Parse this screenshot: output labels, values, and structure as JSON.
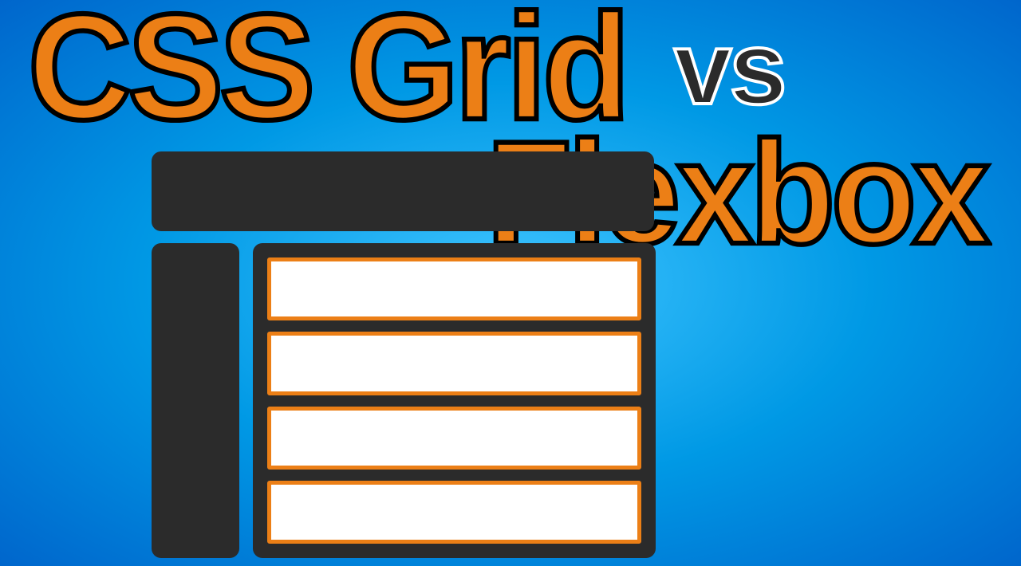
{
  "title": {
    "part1": "CSS Grid",
    "vs": "vs",
    "part2": "Flexbox"
  },
  "colors": {
    "accent_orange": "#ec7f16",
    "dark_block": "#2b2b2b",
    "white_row": "#ffffff"
  },
  "diagram": {
    "flex_rows_count": 4
  }
}
